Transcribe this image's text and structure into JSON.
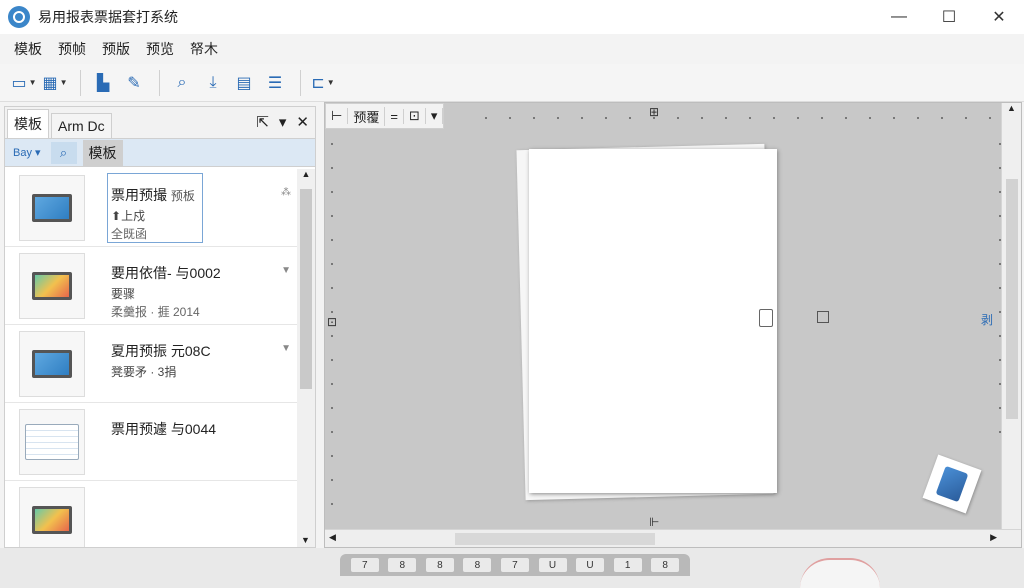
{
  "window": {
    "title": "易用报表票据套打系统",
    "minimize": "—",
    "maximize": "☐",
    "close": "✕"
  },
  "menu": [
    "模板",
    "预帧",
    "预版",
    "预览",
    "帑木"
  ],
  "toolbar": {
    "icons": [
      "open-folder-icon",
      "tools-icon",
      "book-icon",
      "wand-icon",
      "search-icon",
      "import-icon",
      "print-icon",
      "list-icon",
      "layout-icon"
    ]
  },
  "left_panel": {
    "tabs": [
      "模板",
      "Arm Dc"
    ],
    "filter_select": "Bay",
    "filter_label": "模板",
    "items": [
      {
        "title": "票用预撮",
        "tag": "预板",
        "line1": "上戍",
        "line2": "全既函",
        "arrow": "⁂"
      },
      {
        "title": "要用依借- 与0002",
        "tag": "",
        "line1": "要骤",
        "line2": "柔羹报 · 捱 2014",
        "arrow": "▼"
      },
      {
        "title": "夏用预振 元08C",
        "tag": "",
        "line1": "凳要矛 · 3捐",
        "line2": "",
        "arrow": "▼"
      },
      {
        "title": "票用预遽 与0044",
        "tag": "",
        "line1": "",
        "line2": "",
        "arrow": ""
      },
      {
        "title": "",
        "tag": "",
        "line1": "",
        "line2": "",
        "arrow": ""
      }
    ]
  },
  "canvas": {
    "tool_labels": [
      "⊢",
      "预覆",
      "=",
      "⊡",
      "▾"
    ],
    "top_marker": "⊞",
    "left_marker": "⊡",
    "right_marker": "剥",
    "bottom_marker": "⊩"
  },
  "keyboard_keys": [
    "7",
    "8",
    "8",
    "8",
    "7",
    "U",
    "U",
    "1",
    "8"
  ]
}
